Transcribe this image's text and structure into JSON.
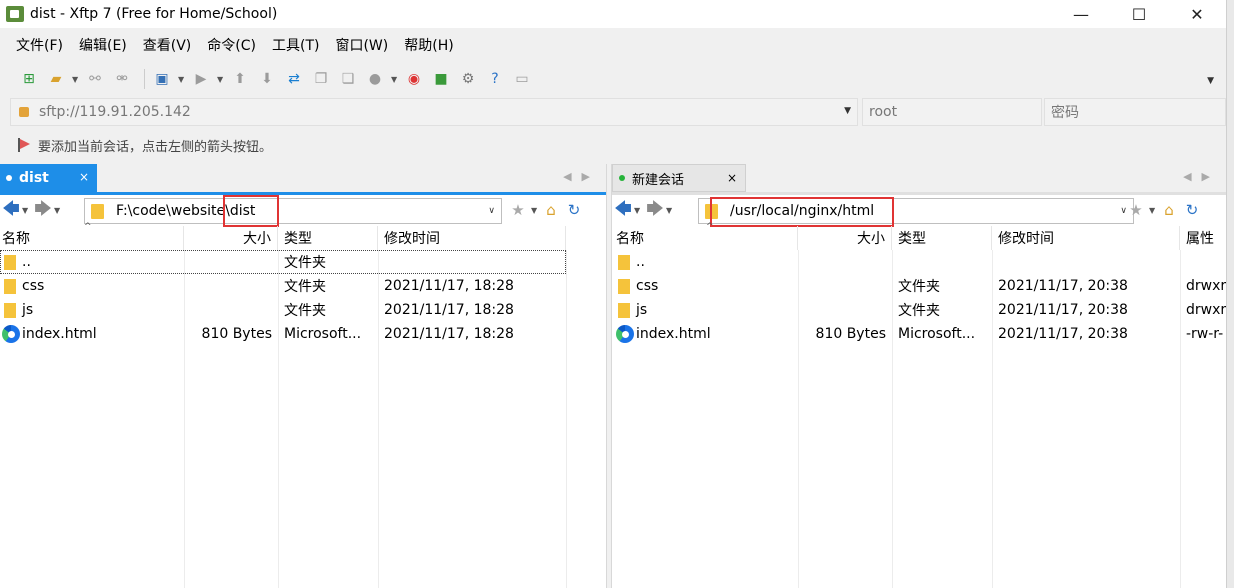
{
  "window": {
    "title": "dist - Xftp 7 (Free for Home/School)",
    "min_icon": "minimize-icon",
    "max_icon": "maximize-icon",
    "close_icon": "close-icon"
  },
  "menu": [
    {
      "label": "文件(F)"
    },
    {
      "label": "编辑(E)"
    },
    {
      "label": "查看(V)"
    },
    {
      "label": "命令(C)"
    },
    {
      "label": "工具(T)"
    },
    {
      "label": "窗口(W)"
    },
    {
      "label": "帮助(H)"
    }
  ],
  "toolbar": {
    "icons": [
      "new-session-icon",
      "open-folder-icon",
      "connect-icon",
      "disconnect-icon",
      "new-window-icon",
      "play-icon",
      "upload-icon",
      "download-icon",
      "transfer-icon",
      "copy-icon",
      "paste-icon",
      "record-icon",
      "xshell-icon",
      "xftp-icon",
      "gear-icon",
      "help-icon",
      "chat-icon"
    ]
  },
  "address": {
    "host_placeholder": "sftp://119.91.205.142",
    "user_placeholder": "root",
    "password_placeholder": "密码"
  },
  "hint": {
    "text": "要添加当前会话，点击左侧的箭头按钮。"
  },
  "left_pane": {
    "tab_label": "dist",
    "tab_close": "×",
    "path": "F:\\code\\website\\dist",
    "columns": {
      "name": "名称",
      "size": "大小",
      "type": "类型",
      "modified": "修改时间"
    },
    "rows": [
      {
        "name": "..",
        "size": "",
        "type": "文件夹",
        "modified": "",
        "icon": "folder"
      },
      {
        "name": "css",
        "size": "",
        "type": "文件夹",
        "modified": "2021/11/17, 18:28",
        "icon": "folder"
      },
      {
        "name": "js",
        "size": "",
        "type": "文件夹",
        "modified": "2021/11/17, 18:28",
        "icon": "folder"
      },
      {
        "name": "index.html",
        "size": "810 Bytes",
        "type": "Microsoft...",
        "modified": "2021/11/17, 18:28",
        "icon": "edge"
      }
    ]
  },
  "right_pane": {
    "tab_label": "新建会话",
    "tab_close": "×",
    "path": "/usr/local/nginx/html",
    "columns": {
      "name": "名称",
      "size": "大小",
      "type": "类型",
      "modified": "修改时间",
      "attr": "属性"
    },
    "rows": [
      {
        "name": "..",
        "size": "",
        "type": "",
        "modified": "",
        "attr": "",
        "icon": "folder"
      },
      {
        "name": "css",
        "size": "",
        "type": "文件夹",
        "modified": "2021/11/17, 20:38",
        "attr": "drwxr",
        "icon": "folder"
      },
      {
        "name": "js",
        "size": "",
        "type": "文件夹",
        "modified": "2021/11/17, 20:38",
        "attr": "drwxr",
        "icon": "folder"
      },
      {
        "name": "index.html",
        "size": "810 Bytes",
        "type": "Microsoft...",
        "modified": "2021/11/17, 20:38",
        "attr": "-rw-r-",
        "icon": "edge"
      }
    ]
  },
  "colors": {
    "accent": "#1e8ee8",
    "highlight_box": "#e03434",
    "folder": "#f5c33b"
  }
}
